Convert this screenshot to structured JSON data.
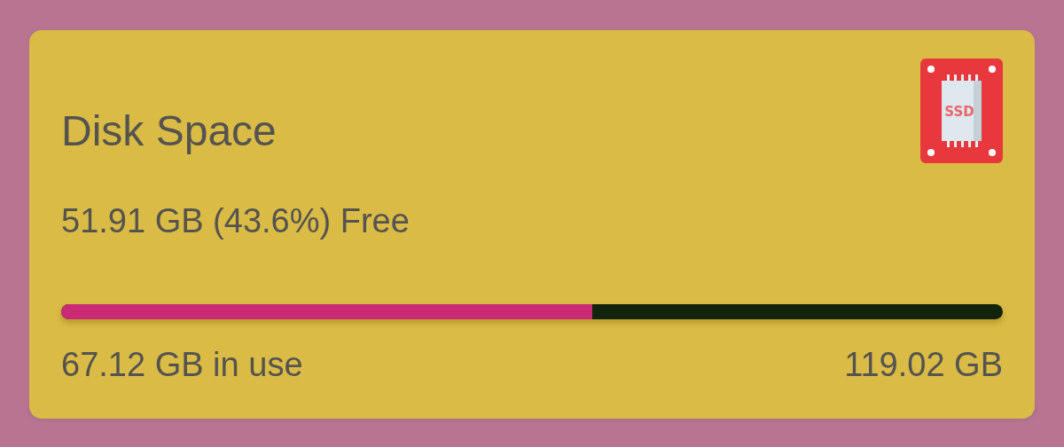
{
  "card": {
    "title": "Disk Space",
    "icon_label": "SSD",
    "free": "51.91 GB (43.6%) Free",
    "usage": {
      "level": 0.564
    },
    "used": "67.12 GB in use",
    "total": "119.02 GB"
  }
}
